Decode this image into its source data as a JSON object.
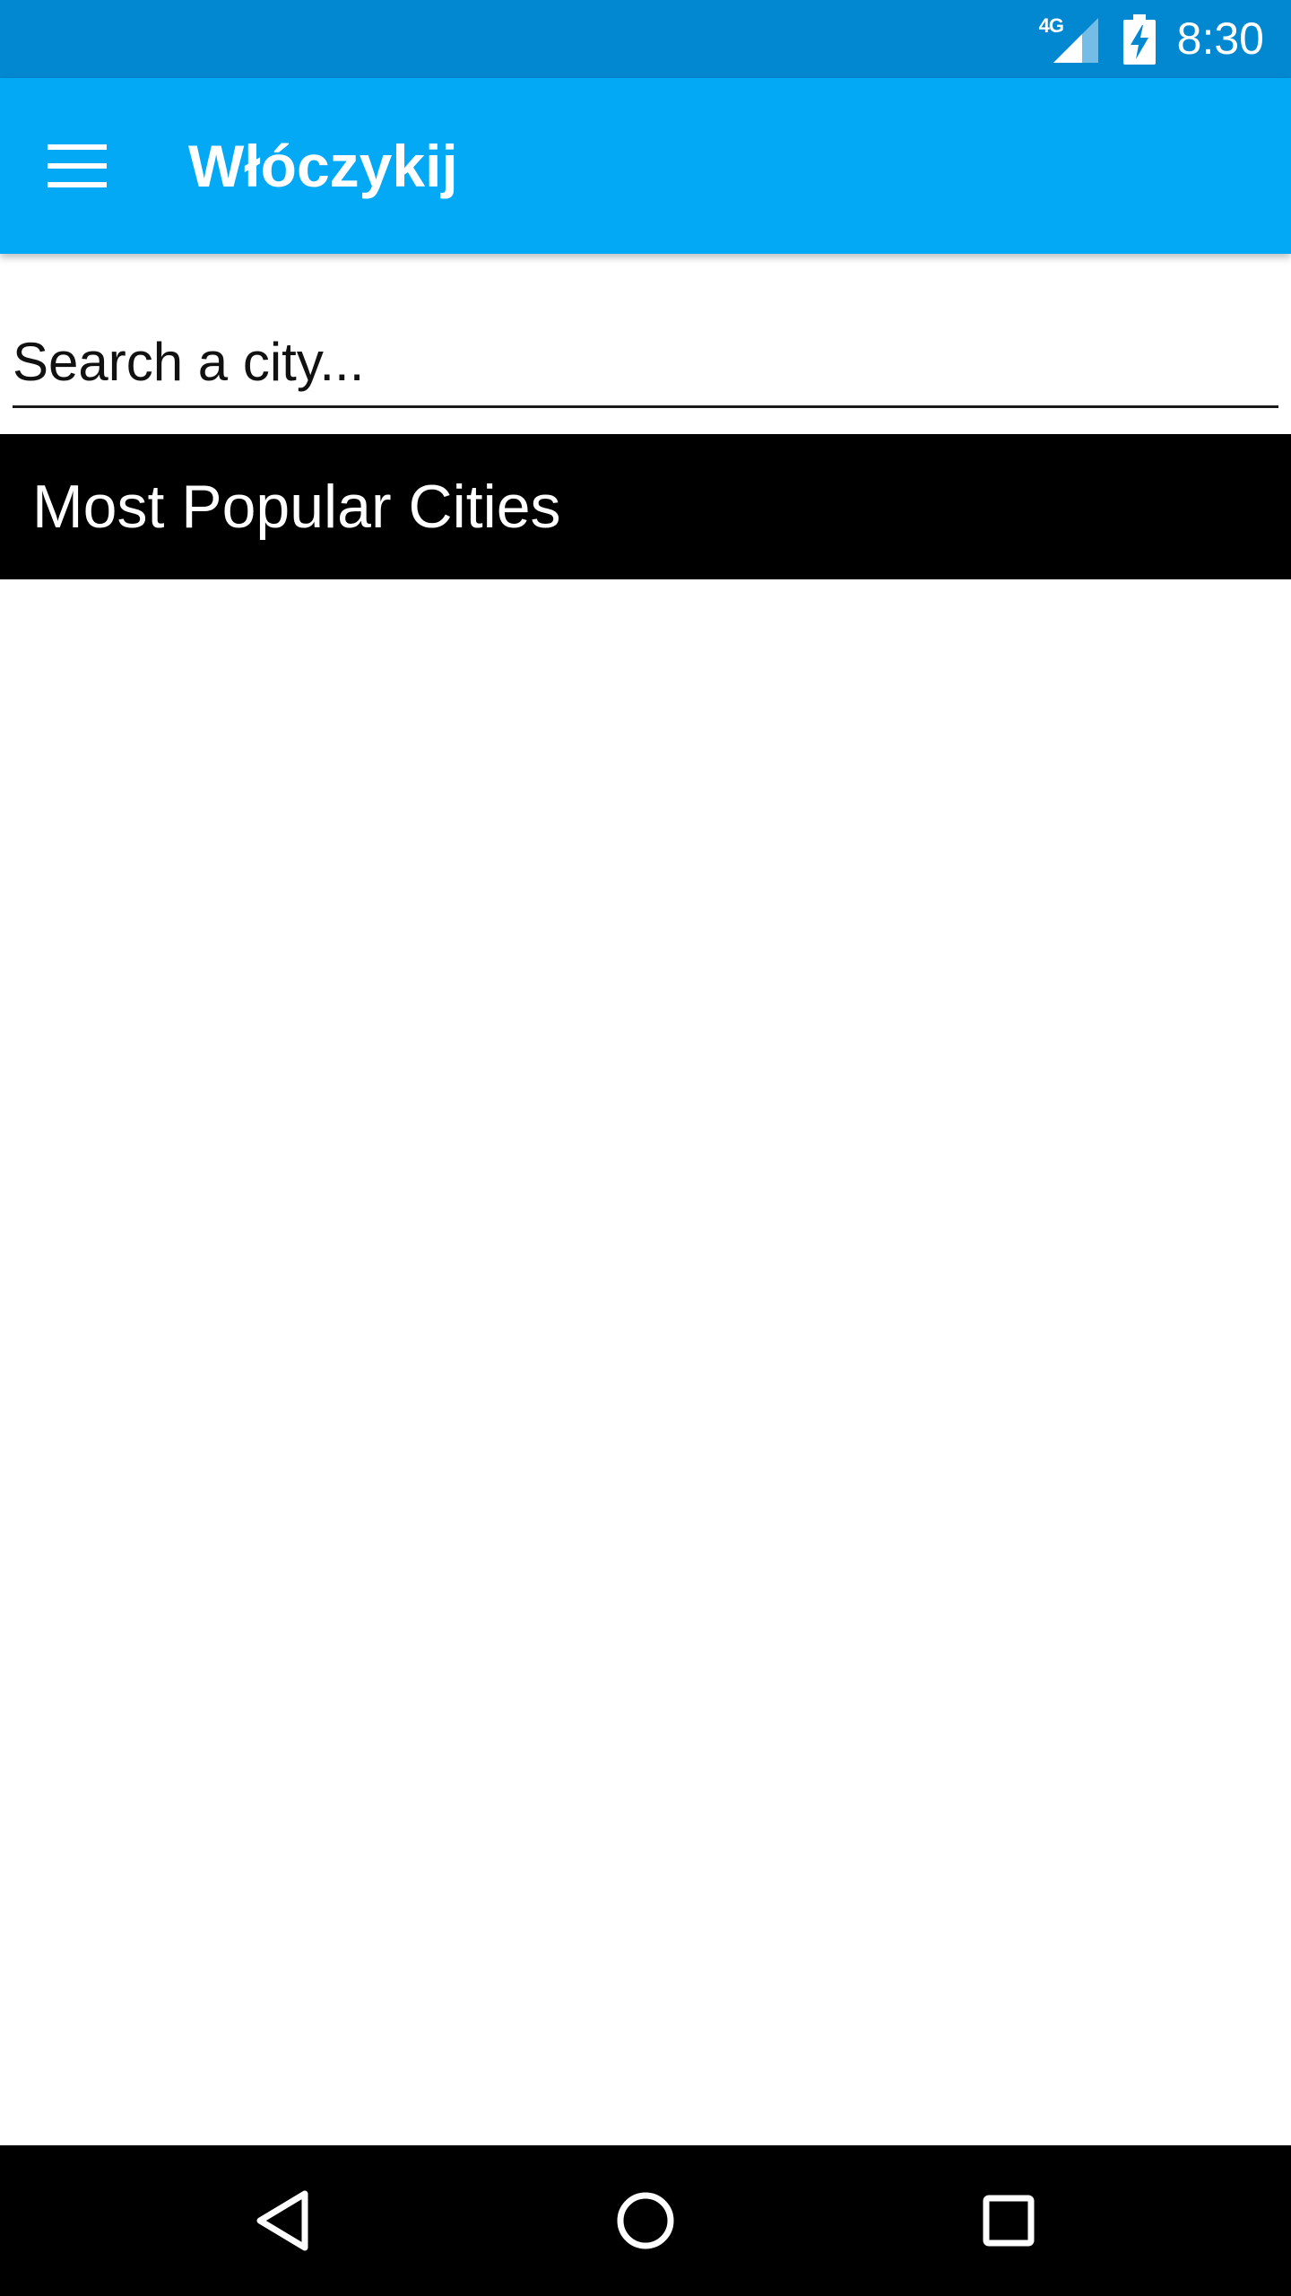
{
  "status_bar": {
    "network_label": "4G",
    "time": "8:30"
  },
  "app_bar": {
    "title": "Włóczykij",
    "menu_icon": "hamburger-menu-icon"
  },
  "search": {
    "placeholder": "Search a city...",
    "value": ""
  },
  "section": {
    "title": "Most Popular Cities"
  },
  "nav_bar": {
    "back_icon": "back-triangle-icon",
    "home_icon": "home-circle-icon",
    "recents_icon": "recents-square-icon"
  },
  "colors": {
    "status_bar": "#0288d1",
    "app_bar": "#03a9f4",
    "section_header": "#000000",
    "nav_bar": "#000000"
  }
}
